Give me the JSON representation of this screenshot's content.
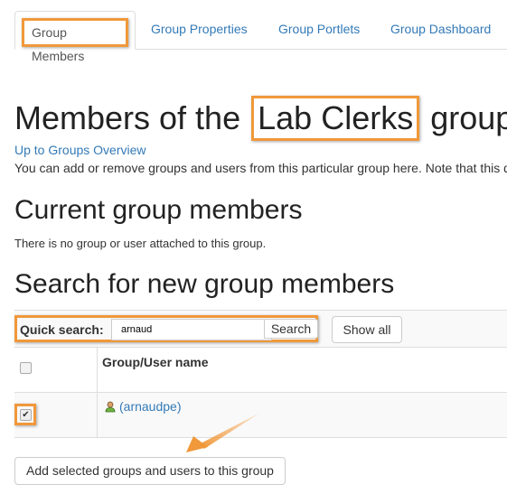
{
  "tabs": [
    {
      "label": "Group Members",
      "active": true
    },
    {
      "label": "Group Properties",
      "active": false
    },
    {
      "label": "Group Portlets",
      "active": false
    },
    {
      "label": "Group Dashboard",
      "active": false
    }
  ],
  "page": {
    "title_prefix": "Members of the",
    "group_name": "Lab Clerks",
    "title_suffix": "group",
    "up_link": "Up to Groups Overview",
    "description": "You can add or remove groups and users from this particular group here. Note that this d"
  },
  "current_members": {
    "heading": "Current group members",
    "empty_text": "There is no group or user attached to this group."
  },
  "search": {
    "heading": "Search for new group members",
    "label": "Quick search:",
    "value": "arnaud",
    "search_button": "Search",
    "show_all_button": "Show all"
  },
  "results": {
    "column_header": "Group/User name",
    "select_all_checked": false,
    "rows": [
      {
        "name": "(arnaudpe)",
        "checked": true,
        "icon": "user-icon"
      }
    ]
  },
  "actions": {
    "add_button": "Add selected groups and users to this group"
  },
  "colors": {
    "highlight": "#f0983a",
    "link": "#337ab7"
  }
}
